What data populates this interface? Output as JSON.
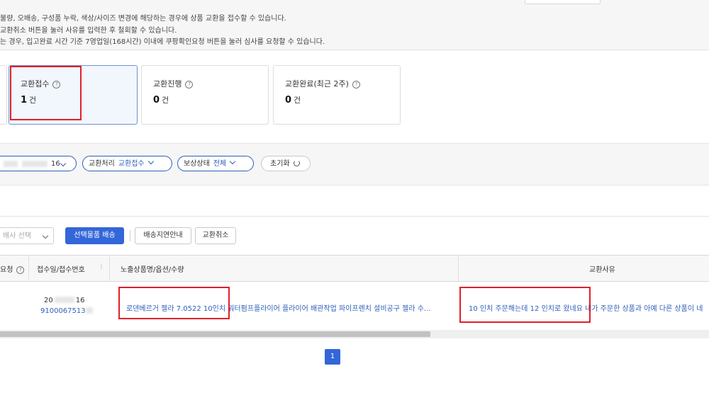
{
  "notice": {
    "lines": [
      "불량, 오배송, 구성품 누락, 색상/사이즈 변경에 해당하는 경우에 상품 교환을 접수할 수 있습니다.",
      "교환취소 버튼을 눌러 사유를 입력한 후 철회할 수 있습니다.",
      "는 경우, 입고완료 시간 기준 7영업일(168시간) 이내에 쿠팡확인요청 버튼을 눌러 심사를 요청할 수 있습니다."
    ]
  },
  "cards": [
    {
      "label": "교환접수",
      "count": "1",
      "unit": "건"
    },
    {
      "label": "교환진행",
      "count": "0",
      "unit": "건"
    },
    {
      "label": "교환완료(최근 2주)",
      "count": "0",
      "unit": "건"
    }
  ],
  "filters": {
    "date_suffix": "16",
    "exchange_label": "교환처리",
    "exchange_value": "교환접수",
    "compensation_label": "보상상태",
    "compensation_value": "전체",
    "reset_label": "초기화"
  },
  "toolbar": {
    "select_placeholder": "배사 선택",
    "ship_selected": "선택물품 배송",
    "delay_notice": "배송지연안내",
    "cancel_exchange": "교환취소"
  },
  "table": {
    "headers": {
      "col0": "요청",
      "col1": "접수일/접수번호",
      "col2": "노출상품명/옵션/수량",
      "col3": "교환사유"
    },
    "rows": [
      {
        "date_prefix": "20",
        "date_suffix": "16",
        "receipt_no": "9100067513",
        "product": "로덴베르거 젤라 7.0522 10인치 워터펌프플라이어 플라이어 배관작업 파이프렌치 설비공구 젤라 수...",
        "reason": "10 인치 주문해는데 12 인치로 왔네요 내가 주문한 상품과 아예 다른 상품이 네"
      }
    ]
  },
  "pagination": {
    "current": "1"
  }
}
